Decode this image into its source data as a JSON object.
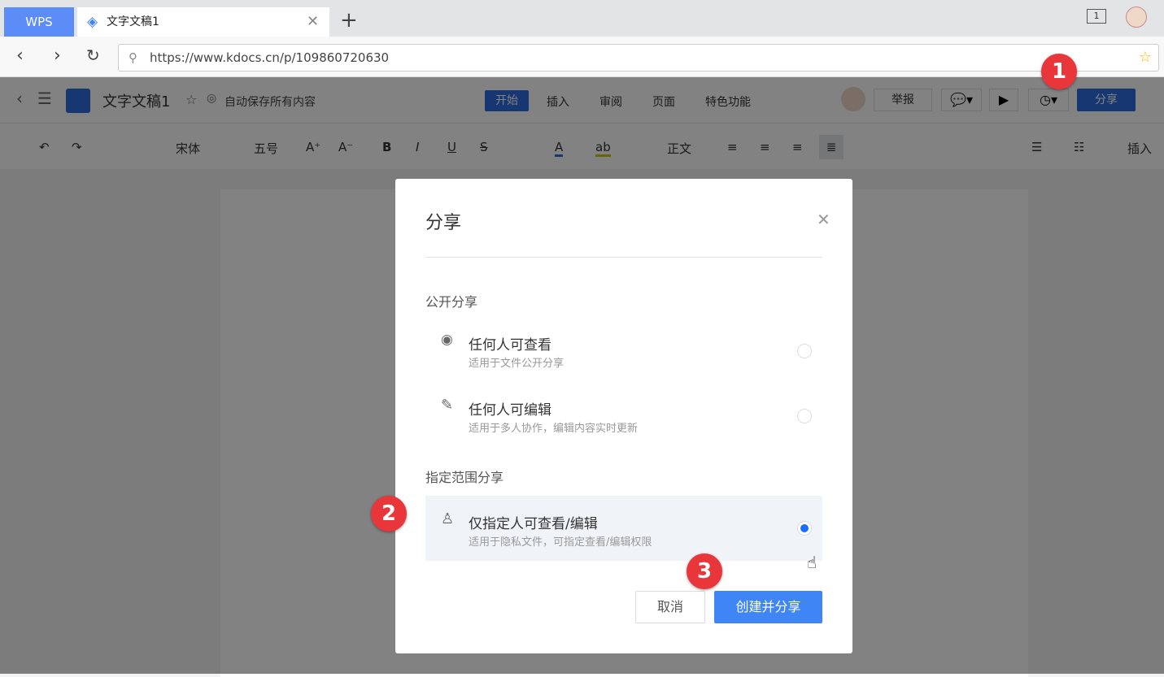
{
  "browser": {
    "tabs": [
      {
        "label": "WPS"
      },
      {
        "label": "文字文稿1"
      }
    ],
    "url": "https://www.kdocs.cn/p/109860720630",
    "tab_counter": "1"
  },
  "header": {
    "doc_title": "文字文稿1",
    "save_status": "自动保存所有内容",
    "menu": [
      "开始",
      "插入",
      "审阅",
      "页面",
      "特色功能"
    ],
    "active_menu": "开始",
    "report": "举报",
    "share": "分享"
  },
  "toolbar": {
    "font": "宋体",
    "size": "五号",
    "style": "正文",
    "insert": "插入"
  },
  "dialog": {
    "title": "分享",
    "public_section": "公开分享",
    "options": [
      {
        "title": "任何人可查看",
        "desc": "适用于文件公开分享",
        "icon": "eye-icon",
        "selected": false
      },
      {
        "title": "任何人可编辑",
        "desc": "适用于多人协作，编辑内容实时更新",
        "icon": "pencil-icon",
        "selected": false
      },
      {
        "title": "仅指定人可查看/编辑",
        "desc": "适用于隐私文件，可指定查看/编辑权限",
        "icon": "user-check-icon",
        "selected": true
      }
    ],
    "restricted_section": "指定范围分享",
    "cancel": "取消",
    "confirm": "创建并分享"
  },
  "annotations": [
    "1",
    "2",
    "3"
  ],
  "colors": {
    "primary": "#3f85f6",
    "badge": "#e8363a"
  }
}
